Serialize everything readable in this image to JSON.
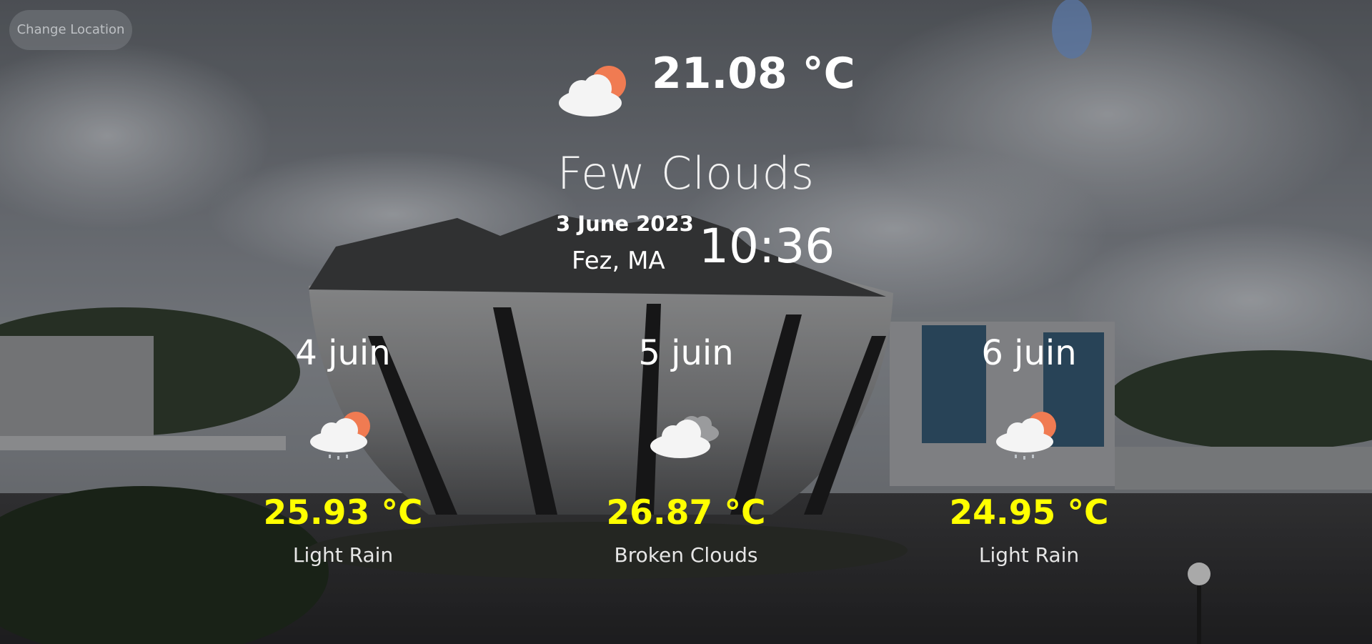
{
  "header": {
    "change_location_label": "Change Location"
  },
  "current": {
    "temperature": "21.08 °C",
    "condition": "Few Clouds",
    "date": "3 June 2023",
    "location": "Fez, MA",
    "time": "10:36",
    "icon": "few-clouds-icon"
  },
  "forecast": [
    {
      "day": "4 juin",
      "temperature": "25.93 °C",
      "description": "Light Rain",
      "icon": "light-rain-icon"
    },
    {
      "day": "5 juin",
      "temperature": "26.87 °C",
      "description": "Broken Clouds",
      "icon": "broken-clouds-icon"
    },
    {
      "day": "6 juin",
      "temperature": "24.95 °C",
      "description": "Light Rain",
      "icon": "light-rain-icon"
    }
  ],
  "colors": {
    "forecast_temperature": "#ffff00",
    "sun": "#f07b52",
    "primary_text": "#ffffff"
  }
}
